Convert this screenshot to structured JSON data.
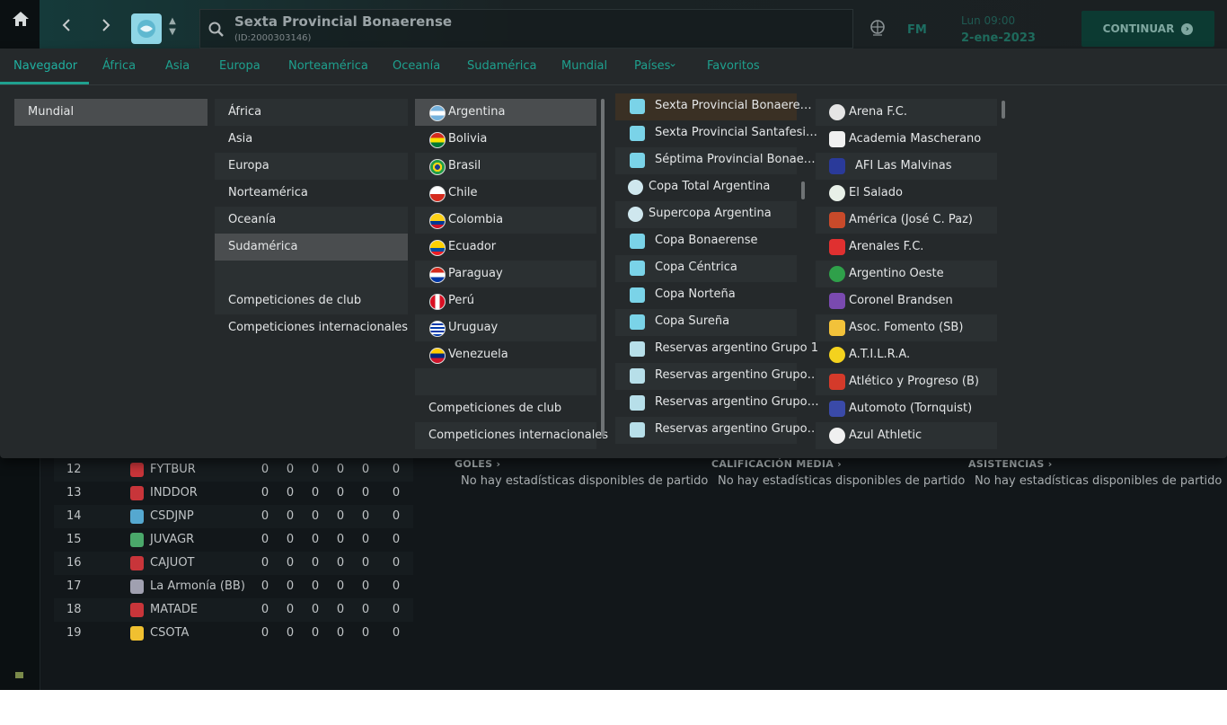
{
  "topbar": {
    "title": "Sexta Provincial Bonaerense",
    "id_text": "(ID:2000303146)",
    "brand": "FM",
    "day_time": "Lun 09:00",
    "date": "2-ene-2023",
    "continue_label": "CONTINUAR"
  },
  "tabs": [
    "Navegador",
    "África",
    "Asia",
    "Europa",
    "Norteamérica",
    "Oceanía",
    "Sudamérica",
    "Mundial",
    "Países",
    "Favoritos"
  ],
  "col1": [
    "Mundial"
  ],
  "col2": {
    "regions": [
      "África",
      "Asia",
      "Europa",
      "Norteamérica",
      "Oceanía",
      "Sudamérica"
    ],
    "links": [
      "Competiciones de club",
      "Competiciones internacionales"
    ]
  },
  "col3": {
    "countries": [
      "Argentina",
      "Bolivia",
      "Brasil",
      "Chile",
      "Colombia",
      "Ecuador",
      "Paraguay",
      "Perú",
      "Uruguay",
      "Venezuela"
    ],
    "links": [
      "Competiciones de club",
      "Competiciones internacionales"
    ]
  },
  "col4": [
    "Sexta Provincial Bonaere…",
    "Sexta Provincial Santafesi…",
    "Séptima Provincial Bonae…",
    "Copa Total Argentina",
    "Supercopa Argentina",
    "Copa Bonaerense",
    "Copa Céntrica",
    "Copa Norteña",
    "Copa Sureña",
    "Reservas argentino Grupo 1",
    "Reservas argentino Grupo…",
    "Reservas argentino Grupo…",
    "Reservas argentino Grupo…"
  ],
  "col5": [
    "Arena F.C.",
    "Academia Mascherano",
    "AFI Las Malvinas",
    "El Salado",
    "América (José C. Paz)",
    "Arenales F.C.",
    "Argentino Oeste",
    "Coronel Brandsen",
    "Asoc. Fomento (SB)",
    "A.T.I.L.R.A.",
    "Atlético y Progreso (B)",
    "Automoto (Tornquist)",
    "Azul Athletic"
  ],
  "table": {
    "rows": [
      {
        "pos": "12",
        "name": "FYTBUR",
        "stats": [
          "0",
          "0",
          "0",
          "0",
          "0",
          "0"
        ]
      },
      {
        "pos": "13",
        "name": "INDDOR",
        "stats": [
          "0",
          "0",
          "0",
          "0",
          "0",
          "0"
        ]
      },
      {
        "pos": "14",
        "name": "CSDJNP",
        "stats": [
          "0",
          "0",
          "0",
          "0",
          "0",
          "0"
        ]
      },
      {
        "pos": "15",
        "name": "JUVAGR",
        "stats": [
          "0",
          "0",
          "0",
          "0",
          "0",
          "0"
        ]
      },
      {
        "pos": "16",
        "name": "CAJUOT",
        "stats": [
          "0",
          "0",
          "0",
          "0",
          "0",
          "0"
        ]
      },
      {
        "pos": "17",
        "name": "La Armonía (BB)",
        "stats": [
          "0",
          "0",
          "0",
          "0",
          "0",
          "0"
        ]
      },
      {
        "pos": "18",
        "name": "MATADE",
        "stats": [
          "0",
          "0",
          "0",
          "0",
          "0",
          "0"
        ]
      },
      {
        "pos": "19",
        "name": "CSOTA",
        "stats": [
          "0",
          "0",
          "0",
          "0",
          "0",
          "0"
        ]
      }
    ]
  },
  "stats": [
    {
      "title": "GOLES",
      "text": "No hay estadísticas disponibles de partido"
    },
    {
      "title": "CALIFICACIÓN MEDIA",
      "text": "No hay estadísticas disponibles de partido"
    },
    {
      "title": "ASISTENCIAS",
      "text": "No hay estadísticas disponibles de partido"
    }
  ],
  "colors": {
    "accent": "#1fa08f",
    "panel": "#25292b",
    "background": "#12171a"
  }
}
